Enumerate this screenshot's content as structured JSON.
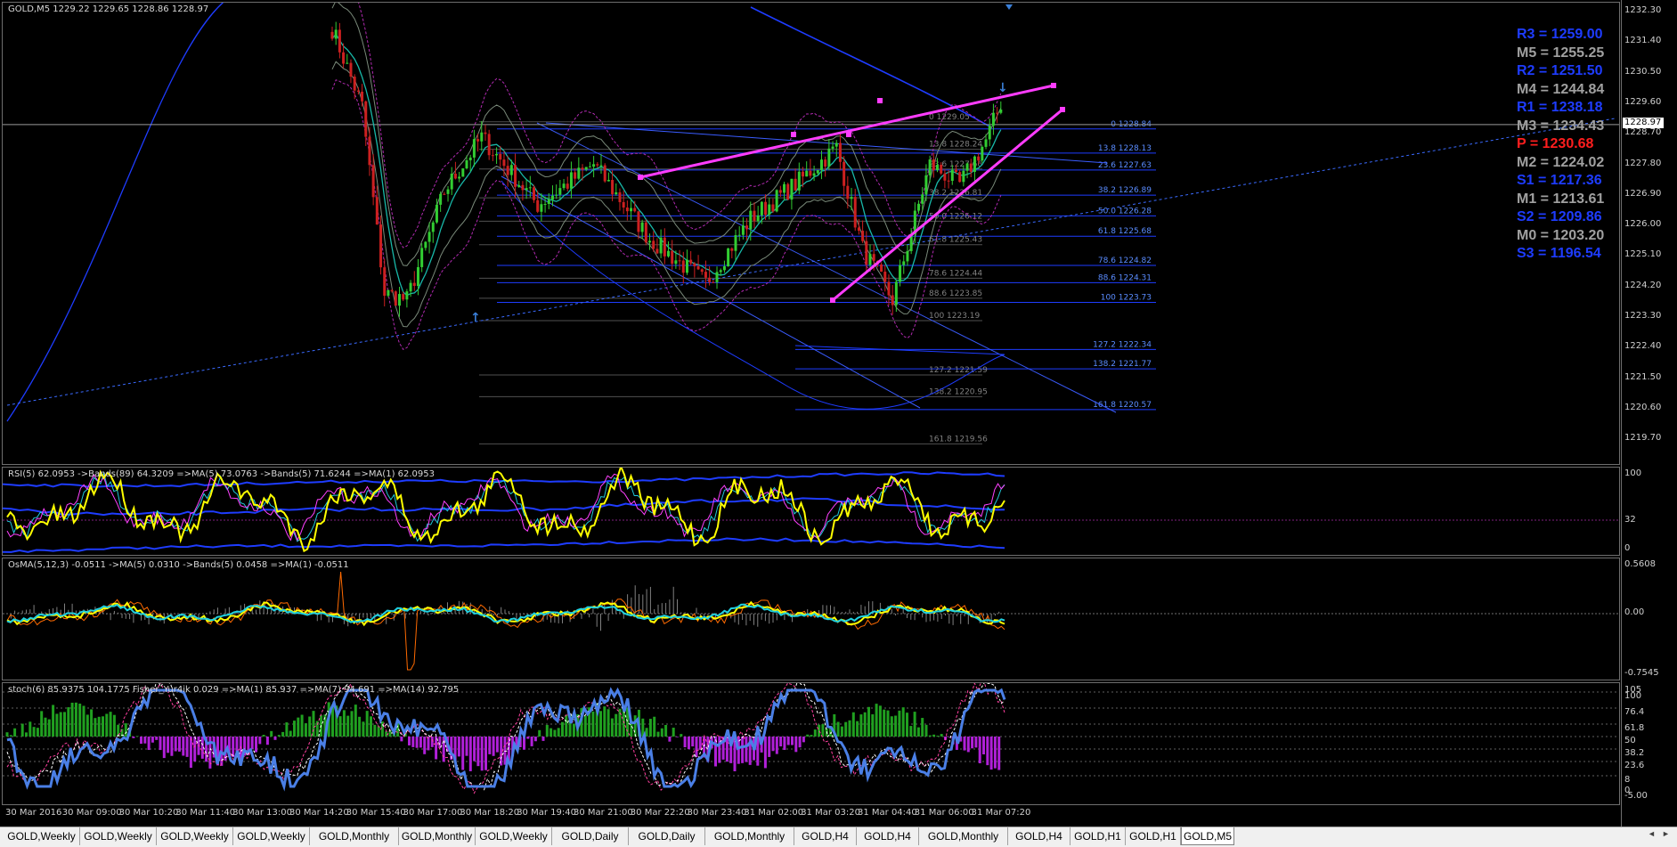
{
  "colors": {
    "background": "#000000",
    "bull_candle": "#32cd32",
    "bear_candle": "#cc2020",
    "channel_line": "#ff3cff",
    "pivot_blue": "#1e3cff",
    "pivot_gray": "#a0a0a0",
    "pivot_red": "#ff1e1e",
    "rsi_line": "#ffff00",
    "stoch_line": "#4a7fe6"
  },
  "main_chart": {
    "title": "GOLD,M5  1229.22 1229.65 1228.86 1228.97",
    "current_price": "1228.97",
    "price_axis": [
      "1232.30",
      "1231.40",
      "1230.50",
      "1229.60",
      "1228.70",
      "1227.80",
      "1226.90",
      "1226.00",
      "1225.10",
      "1224.20",
      "1223.30",
      "1222.40",
      "1221.50",
      "1220.60",
      "1219.70"
    ],
    "fib_levels_right": [
      {
        "label": "0 1228.84"
      },
      {
        "label": "13.8 1228.13"
      },
      {
        "label": "23.6 1227.63"
      },
      {
        "label": "38.2 1226.89"
      },
      {
        "label": "50.0 1226.28"
      },
      {
        "label": "61.8 1225.68"
      },
      {
        "label": "78.6 1224.82"
      },
      {
        "label": "88.6 1224.31"
      },
      {
        "label": "100 1223.73"
      },
      {
        "label": "127.2 1222.34"
      },
      {
        "label": "138.2 1221.77"
      },
      {
        "label": "161.8 1220.57"
      }
    ],
    "fib_levels_left": [
      {
        "label": "0 1229.05"
      },
      {
        "label": "13.8 1228.24"
      },
      {
        "label": "23.6 1227.66"
      },
      {
        "label": "38.2 1226.81"
      },
      {
        "label": "50.0 1226.12"
      },
      {
        "label": "61.8 1225.43"
      },
      {
        "label": "78.6 1224.44"
      },
      {
        "label": "88.6 1223.85"
      },
      {
        "label": "100 1223.19"
      },
      {
        "label": "127.2 1221.59"
      },
      {
        "label": "138.2 1220.95"
      },
      {
        "label": "161.8 1219.56"
      }
    ]
  },
  "pivots": [
    {
      "label": "R3 = 1259.00",
      "color": "#1e3cff"
    },
    {
      "label": "M5 = 1255.25",
      "color": "#a0a0a0"
    },
    {
      "label": "R2 = 1251.50",
      "color": "#1e3cff"
    },
    {
      "label": "M4 = 1244.84",
      "color": "#a0a0a0"
    },
    {
      "label": "R1 = 1238.18",
      "color": "#1e3cff"
    },
    {
      "label": "M3 = 1234.43",
      "color": "#a0a0a0"
    },
    {
      "label": "P  = 1230.68",
      "color": "#ff1e1e"
    },
    {
      "label": "M2 = 1224.02",
      "color": "#a0a0a0"
    },
    {
      "label": "S1 = 1217.36",
      "color": "#1e3cff"
    },
    {
      "label": "M1 = 1213.61",
      "color": "#a0a0a0"
    },
    {
      "label": "S2 = 1209.86",
      "color": "#1e3cff"
    },
    {
      "label": "M0 = 1203.20",
      "color": "#a0a0a0"
    },
    {
      "label": "S3 = 1196.54",
      "color": "#1e3cff"
    }
  ],
  "rsi": {
    "label": "RSI(5) 62.0953  ->Bands(89) 64.3209  =>MA(5) 73.0763  ->Bands(5) 71.6244  =>MA(1) 62.0953",
    "axis": [
      "100",
      "32",
      "0"
    ]
  },
  "osma": {
    "label": "OsMA(5,12,3) -0.0511  ->MA(5) 0.0310  ->Bands(5) 0.0458  =>MA(1) -0.0511",
    "axis": [
      "0.5608",
      "0.00",
      "-0.7545"
    ]
  },
  "stoch": {
    "label": "stoch(6) 85.9375 104.1775  Fisher_Yur4ik 0.029  =>MA(1) 85.937  =>MA(7) 94.691  =>MA(14) 92.795",
    "axis": [
      "105",
      "100",
      "76.4",
      "61.8",
      "50",
      "38.2",
      "23.6",
      "8",
      "0",
      "-5.00"
    ]
  },
  "time_axis": [
    "30 Mar 2016",
    "30 Mar 09:00",
    "30 Mar 10:20",
    "30 Mar 11:40",
    "30 Mar 13:00",
    "30 Mar 14:20",
    "30 Mar 15:40",
    "30 Mar 17:00",
    "30 Mar 18:20",
    "30 Mar 19:40",
    "30 Mar 21:00",
    "30 Mar 22:20",
    "30 Mar 23:40",
    "31 Mar 02:00",
    "31 Mar 03:20",
    "31 Mar 04:40",
    "31 Mar 06:00",
    "31 Mar 07:20"
  ],
  "tabs": [
    {
      "label": "GOLD,Weekly",
      "active": false
    },
    {
      "label": "GOLD,Weekly",
      "active": false
    },
    {
      "label": "GOLD,Weekly",
      "active": false
    },
    {
      "label": "GOLD,Weekly",
      "active": false
    },
    {
      "label": "GOLD,Monthly",
      "active": false
    },
    {
      "label": "GOLD,Monthly",
      "active": false
    },
    {
      "label": "GOLD,Weekly",
      "active": false
    },
    {
      "label": "GOLD,Daily",
      "active": false
    },
    {
      "label": "GOLD,Daily",
      "active": false
    },
    {
      "label": "GOLD,Monthly",
      "active": false
    },
    {
      "label": "GOLD,H4",
      "active": false
    },
    {
      "label": "GOLD,H4",
      "active": false
    },
    {
      "label": "GOLD,Monthly",
      "active": false
    },
    {
      "label": "GOLD,H4",
      "active": false
    },
    {
      "label": "GOLD,H1",
      "active": false
    },
    {
      "label": "GOLD,H1",
      "active": false
    },
    {
      "label": "GOLD,M5",
      "active": true
    }
  ]
}
